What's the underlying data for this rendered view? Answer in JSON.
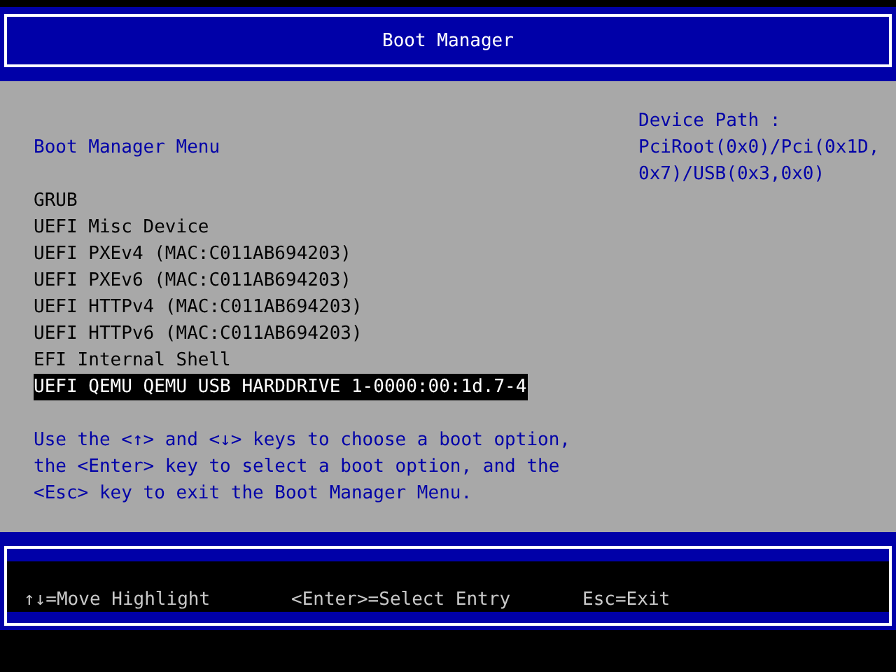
{
  "header": {
    "title": "Boot Manager"
  },
  "menu": {
    "title": "Boot Manager Menu",
    "items": [
      {
        "label": "GRUB",
        "selected": false
      },
      {
        "label": "UEFI Misc Device",
        "selected": false
      },
      {
        "label": "UEFI PXEv4 (MAC:C011AB694203)",
        "selected": false
      },
      {
        "label": "UEFI PXEv6 (MAC:C011AB694203)",
        "selected": false
      },
      {
        "label": "UEFI HTTPv4 (MAC:C011AB694203)",
        "selected": false
      },
      {
        "label": "UEFI HTTPv6 (MAC:C011AB694203)",
        "selected": false
      },
      {
        "label": "EFI Internal Shell",
        "selected": false
      },
      {
        "label": "UEFI QEMU QEMU USB HARDDRIVE 1-0000:00:1d.7-4",
        "selected": true
      }
    ],
    "help_lines": [
      "Use the <↑> and <↓> keys to choose a boot option,",
      "the <Enter> key to select a boot option, and the",
      "<Esc> key to exit the Boot Manager Menu."
    ]
  },
  "device_path": {
    "label": "Device Path :",
    "lines": [
      "PciRoot(0x0)/Pci(0x1D,",
      "0x7)/USB(0x3,0x0)"
    ]
  },
  "footer": {
    "hints": [
      "↑↓=Move Highlight",
      "<Enter>=Select Entry",
      "Esc=Exit"
    ]
  }
}
